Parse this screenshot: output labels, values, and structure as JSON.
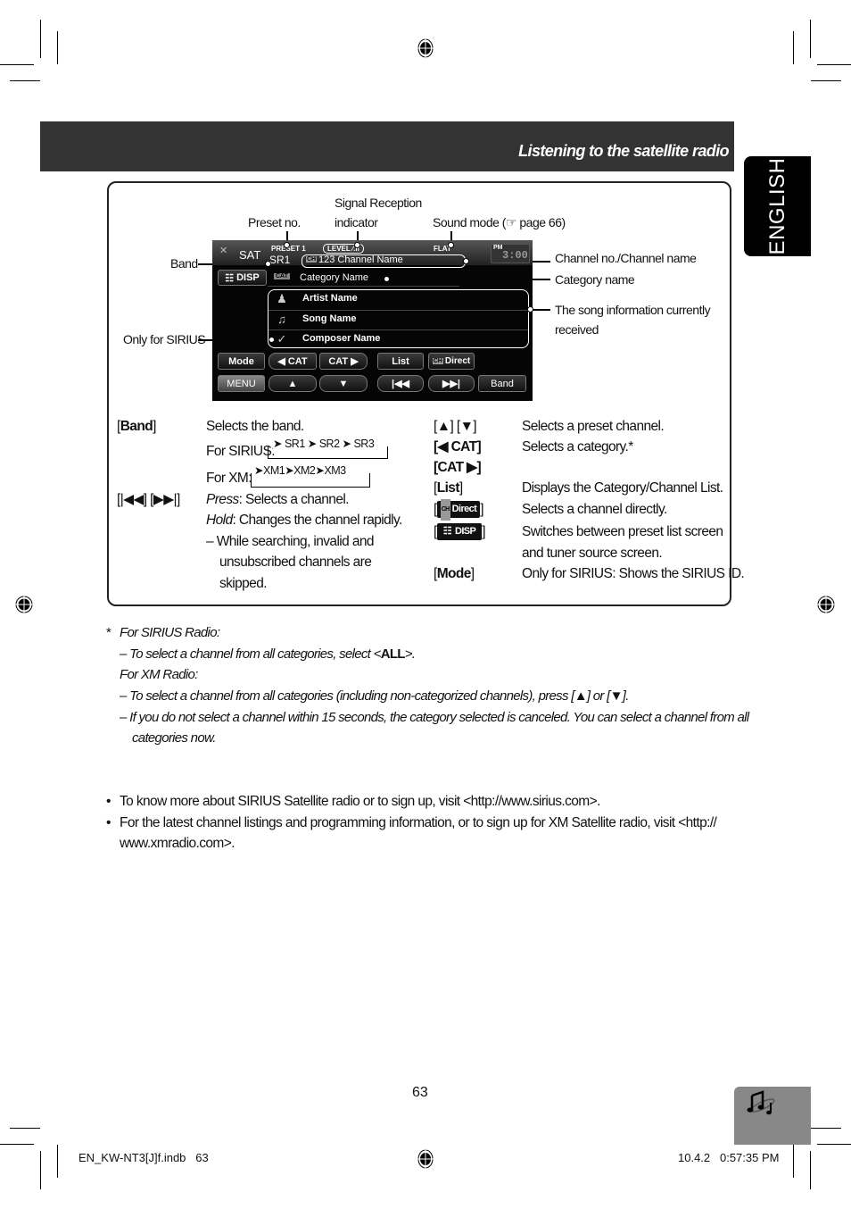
{
  "header": {
    "title": "Listening to the satellite radio"
  },
  "language_tab": {
    "label": "ENGLISH"
  },
  "callouts": {
    "preset_no": "Preset no.",
    "signal_reception": [
      "Signal Reception",
      "indicator"
    ],
    "sound_mode": "Sound mode (☞ page 66)",
    "band": "Band",
    "only_for_sirius": "Only for SIRIUS",
    "channel_name": "Channel no./Channel name",
    "category_name": "Category name",
    "song_info": [
      "The song information currently",
      "received"
    ]
  },
  "screen": {
    "source": "SAT",
    "preset": "PRESET 1",
    "band": "SR1",
    "level": "LEVEL",
    "sound_mode": "FLAT",
    "clock_period": "PM",
    "clock": "3:00",
    "channel": "123  Channel Name",
    "ch_badge": "CH",
    "cat_badge": "CAT",
    "category": "Category Name",
    "disp_button": "DISP",
    "info_rows": [
      {
        "icon": "artist-icon",
        "label": "Artist Name"
      },
      {
        "icon": "music-note-icon",
        "label": "Song Name"
      },
      {
        "icon": "composer-icon",
        "label": "Composer Name"
      }
    ],
    "buttons_row1": [
      "Mode",
      "◀ CAT",
      "CAT ▶",
      "List",
      "Direct"
    ],
    "buttons_row2": [
      "MENU",
      "▲",
      "▼",
      "|◀◀",
      "▶▶|",
      "Band"
    ]
  },
  "descriptions_left": [
    {
      "key": "Band",
      "text": "Selects the band."
    },
    {
      "text": "For SIRIUS:",
      "cycle": [
        "SR1",
        "SR2",
        "SR3"
      ]
    },
    {
      "text": "For XM:",
      "cycle": [
        "XM1",
        "XM2",
        "XM3"
      ]
    },
    {
      "key": "[|◀◀] [▶▶|]",
      "press_label": "Press",
      "press_text": ": Selects a channel.",
      "hold_label": "Hold",
      "hold_text": ": Changes the channel rapidly.",
      "note": [
        "– While searching, invalid and",
        "unsubscribed channels are",
        "skipped."
      ]
    }
  ],
  "descriptions_right": [
    {
      "key": "[▲] [▼]",
      "text": "Selects a preset channel."
    },
    {
      "key": "[◀ CAT]",
      "text": "Selects a category.*"
    },
    {
      "key": "[CAT ▶]",
      "text": ""
    },
    {
      "key": "List",
      "text": "Displays the Category/Channel List."
    },
    {
      "key": "Direct",
      "text": "Selects a channel directly."
    },
    {
      "key": "DISP",
      "text": [
        "Switches between preset list screen",
        "and tuner source screen."
      ]
    },
    {
      "key": "Mode",
      "text": "Only for SIRIUS: Shows the SIRIUS ID."
    }
  ],
  "footnotes": {
    "marker": "*",
    "sirius_heading": "For SIRIUS Radio:",
    "sirius_note_pre": "– To select a channel from all categories, select <",
    "sirius_note_bold": "ALL",
    "sirius_note_post": ">.",
    "xm_heading": "For XM Radio:",
    "xm_note_1": "– To select a channel from all categories (including non-categorized channels), press [▲] or [▼].",
    "xm_note_2": "– If you do not select a channel within 15 seconds, the category selected is canceled. You can select a channel from all",
    "xm_note_2b": "categories now."
  },
  "bullets": [
    "To know more about SIRIUS Satellite radio or to sign up, visit <http://www.sirius.com>.",
    "For the latest channel listings and programming information, or to sign up for XM Satellite radio, visit <http://",
    "www.xmradio.com>."
  ],
  "page_number": "63",
  "footer": {
    "file": "EN_KW-NT3[J]f.indb   63",
    "date": "10.4.2   0:57:35 PM"
  }
}
